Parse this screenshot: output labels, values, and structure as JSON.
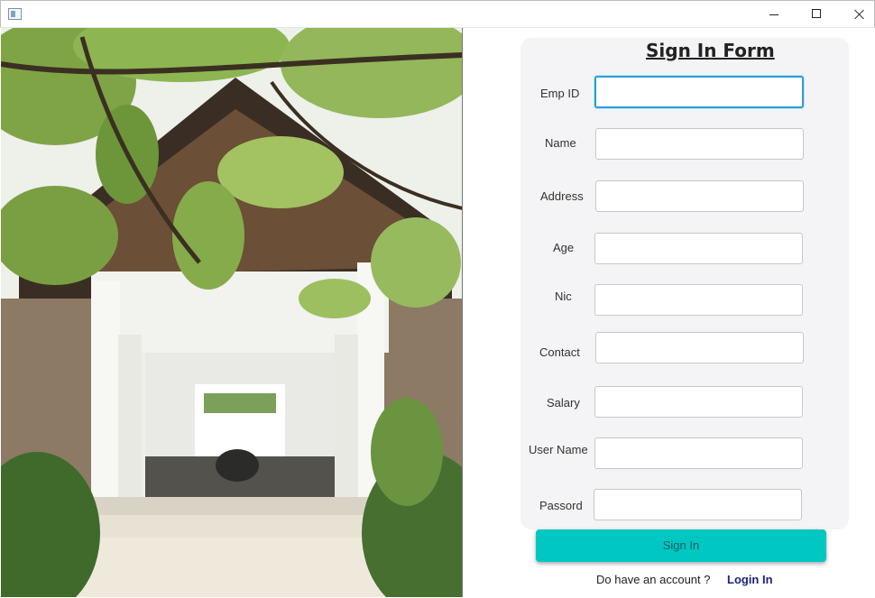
{
  "window": {
    "icon": "app-window-icon",
    "controls": [
      "minimize-icon",
      "maximize-icon",
      "close-icon"
    ]
  },
  "hero_image": {
    "subject": "villa-entrance-photo"
  },
  "form": {
    "title": "Sign In Form",
    "fields": [
      {
        "label": "Emp ID",
        "value": "",
        "focused": true
      },
      {
        "label": "Name",
        "value": ""
      },
      {
        "label": "Address",
        "value": ""
      },
      {
        "label": "Age",
        "value": ""
      },
      {
        "label": "Nic",
        "value": ""
      },
      {
        "label": "Contact",
        "value": ""
      },
      {
        "label": "Salary",
        "value": ""
      },
      {
        "label": "User Name",
        "value": ""
      },
      {
        "label": "Passord",
        "value": ""
      }
    ],
    "submit_label": "Sign In",
    "account_prompt": "Do have an account ?",
    "login_link": "Login In"
  },
  "colors": {
    "accent": "#00c7c1",
    "card_background": "#f4f4f6",
    "link": "#1a237e",
    "focus_border": "#2a9fd6"
  }
}
